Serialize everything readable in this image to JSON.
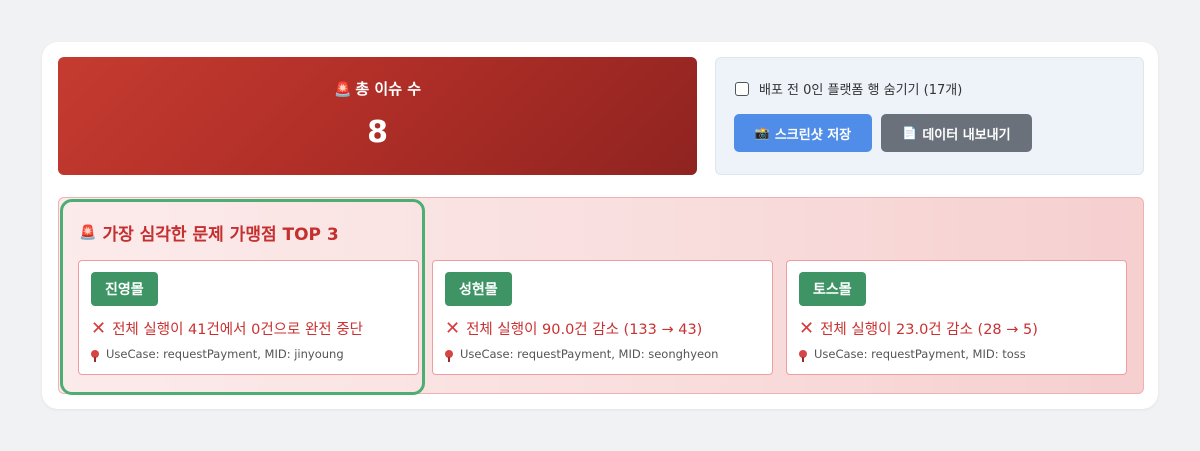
{
  "summary": {
    "siren_icon": "🚨",
    "label": "총 이슈 수",
    "value": "8"
  },
  "controls": {
    "hide_zero_label": "배포 전 0인 플랫폼 행 숨기기 (17개)",
    "hide_zero_checked": false,
    "screenshot_icon": "📸",
    "screenshot_label": "스크린샷 저장",
    "export_icon": "📄",
    "export_label": "데이터 내보내기"
  },
  "top3": {
    "siren_icon": "🚨",
    "title": "가장 심각한 문제 가맹점 TOP 3",
    "stores": [
      {
        "name": "진영몰",
        "issue": "전체 실행이 41건에서 0건으로 완전 중단",
        "meta": "UseCase: requestPayment, MID: jinyoung"
      },
      {
        "name": "성현몰",
        "issue": "전체 실행이 90.0건 감소 (133 → 43)",
        "meta": "UseCase: requestPayment, MID: seonghyeon"
      },
      {
        "name": "토스몰",
        "issue": "전체 실행이 23.0건 감소 (28 → 5)",
        "meta": "UseCase: requestPayment, MID: toss"
      }
    ]
  },
  "colors": {
    "danger": "#c42f2f",
    "badge_green": "#3f9466",
    "primary_button": "#4f8de8",
    "secondary_button": "#6b717b",
    "highlight_border": "#4cae73"
  }
}
